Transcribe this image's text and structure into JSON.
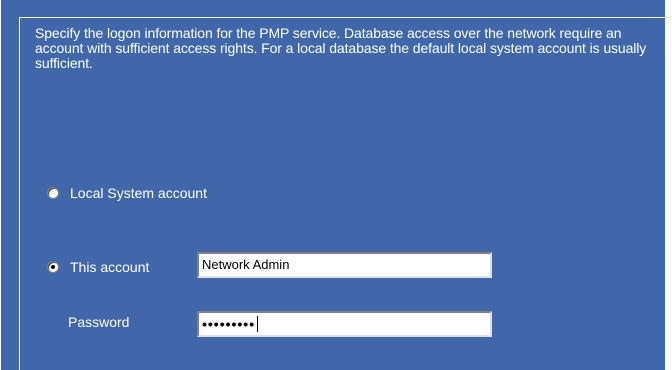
{
  "description": "Specify the logon information for the PMP service. Database access over the network require an account with sufficient access rights. For a local database the default local system account is usually sufficient.",
  "options": {
    "local_system": {
      "label": "Local System account",
      "checked": false
    },
    "this_account": {
      "label": "This account",
      "checked": true
    }
  },
  "account_field": {
    "value": "Network Admin"
  },
  "password": {
    "label": "Password",
    "masked_value": "•••••••••"
  },
  "colors": {
    "panel_background": "#3f67a9",
    "text": "#ffffff"
  }
}
